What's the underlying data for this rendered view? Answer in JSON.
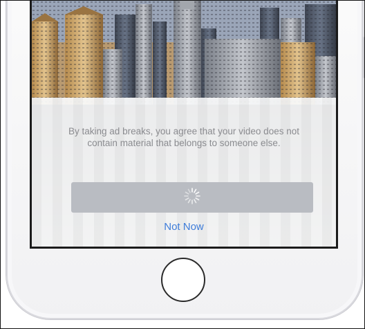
{
  "notice": {
    "text": "By taking ad breaks, you agree that your video does not contain material that belongs to someone else."
  },
  "primary_button": {
    "state": "loading",
    "icon": "spinner-icon"
  },
  "secondary_link": {
    "label": "Not Now"
  },
  "colors": {
    "link": "#3d7cd9",
    "button_disabled": "#b9bcc2",
    "notice_text": "#8a8b8f"
  }
}
